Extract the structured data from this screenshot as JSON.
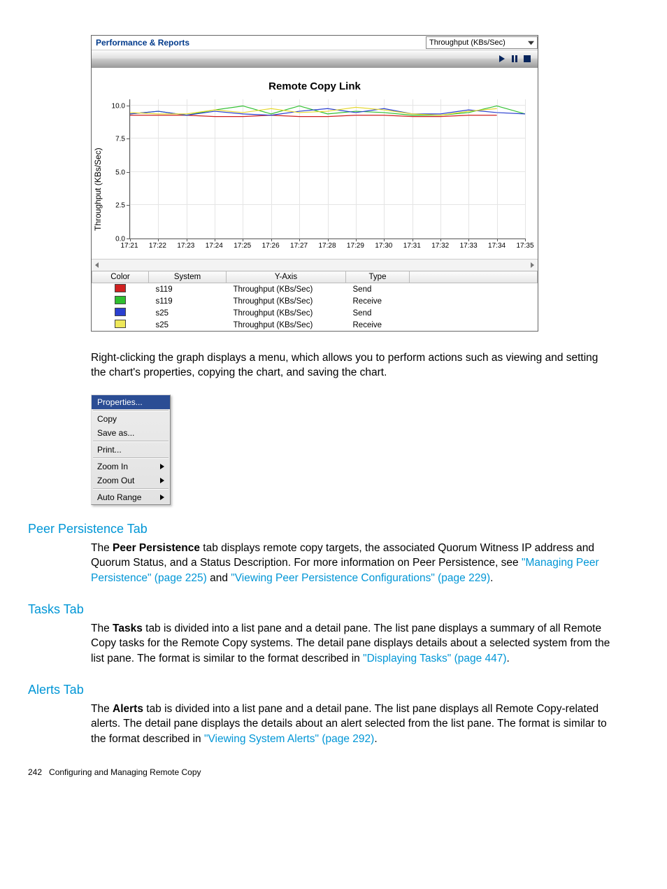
{
  "panel": {
    "title": "Performance & Reports",
    "dropdown_value": "Throughput (KBs/Sec)"
  },
  "chart_data": {
    "type": "line",
    "title": "Remote Copy Link",
    "ylabel": "Throughput (KBs/Sec)",
    "yticks": [
      "0.0",
      "2.5",
      "5.0",
      "7.5",
      "10.0"
    ],
    "ylim": [
      0,
      10.5
    ],
    "categories": [
      "17:21",
      "17:22",
      "17:23",
      "17:24",
      "17:25",
      "17:26",
      "17:27",
      "17:28",
      "17:29",
      "17:30",
      "17:31",
      "17:32",
      "17:33",
      "17:34",
      "17:35"
    ],
    "series": [
      {
        "name": "s119 Send",
        "color": "#d02020",
        "values": [
          9.3,
          9.3,
          9.3,
          9.2,
          9.2,
          9.3,
          9.2,
          9.2,
          9.3,
          9.3,
          9.2,
          9.2,
          9.3,
          9.3,
          null
        ]
      },
      {
        "name": "s119 Receive",
        "color": "#2fbf2f",
        "values": [
          9.4,
          9.6,
          9.3,
          9.7,
          10.0,
          9.4,
          10.0,
          9.4,
          9.6,
          9.5,
          9.3,
          9.3,
          9.5,
          10.0,
          9.4
        ]
      },
      {
        "name": "s25 Send",
        "color": "#2a3fd0",
        "values": [
          9.4,
          9.6,
          9.3,
          9.6,
          9.4,
          9.3,
          9.6,
          9.8,
          9.5,
          9.8,
          9.4,
          9.4,
          9.7,
          9.5,
          9.4
        ]
      },
      {
        "name": "s25 Receive",
        "color": "#e6d830",
        "values": [
          9.5,
          9.4,
          9.4,
          9.7,
          9.5,
          9.8,
          9.5,
          9.6,
          9.9,
          9.7,
          9.4,
          9.3,
          9.6,
          9.8,
          null
        ]
      }
    ]
  },
  "legend": {
    "headers": {
      "color": "Color",
      "system": "System",
      "yaxis": "Y-Axis",
      "type": "Type"
    },
    "rows": [
      {
        "color": "#d02020",
        "system": "s119",
        "yaxis": "Throughput (KBs/Sec)",
        "type": "Send"
      },
      {
        "color": "#2fbf2f",
        "system": "s119",
        "yaxis": "Throughput (KBs/Sec)",
        "type": "Receive"
      },
      {
        "color": "#2a3fd0",
        "system": "s25",
        "yaxis": "Throughput (KBs/Sec)",
        "type": "Send"
      },
      {
        "color": "#eee85a",
        "system": "s25",
        "yaxis": "Throughput (KBs/Sec)",
        "type": "Receive"
      }
    ]
  },
  "caption": "Right-clicking the graph displays a menu, which allows you to perform actions such as viewing and setting the chart's properties, copying the chart, and saving the chart.",
  "ctx_menu": {
    "properties": "Properties...",
    "copy": "Copy",
    "saveas": "Save as...",
    "print": "Print...",
    "zoomin": "Zoom In",
    "zoomout": "Zoom Out",
    "autorange": "Auto Range"
  },
  "sections": {
    "peer": {
      "title": "Peer Persistence Tab",
      "p1a": "The ",
      "p1_bold": "Peer Persistence",
      "p1b": " tab displays remote copy targets, the associated Quorum Witness IP address and Quorum Status, and a Status Description. For more information on Peer Persistence, see ",
      "link1": "\"Managing Peer Persistence\" (page 225)",
      "mid": " and ",
      "link2": "\"Viewing Peer Persistence Configurations\" (page 229)",
      "tail": "."
    },
    "tasks": {
      "title": "Tasks Tab",
      "p1a": "The ",
      "p1_bold": "Tasks",
      "p1b": " tab is divided into a list pane and a detail pane. The list pane displays a summary of all Remote Copy tasks for the Remote Copy systems. The detail pane displays details about a selected system from the list pane. The format is similar to the format described in ",
      "link1": "\"Displaying Tasks\" (page 447)",
      "tail": "."
    },
    "alerts": {
      "title": "Alerts Tab",
      "p1a": "The ",
      "p1_bold": "Alerts",
      "p1b": " tab is divided into a list pane and a detail pane. The list pane displays all Remote Copy-related alerts. The detail pane displays the details about an alert selected from the list pane. The format is similar to the format described in ",
      "link1": "\"Viewing System Alerts\" (page 292)",
      "tail": "."
    }
  },
  "footer": {
    "page": "242",
    "chapter": "Configuring and Managing Remote Copy"
  }
}
